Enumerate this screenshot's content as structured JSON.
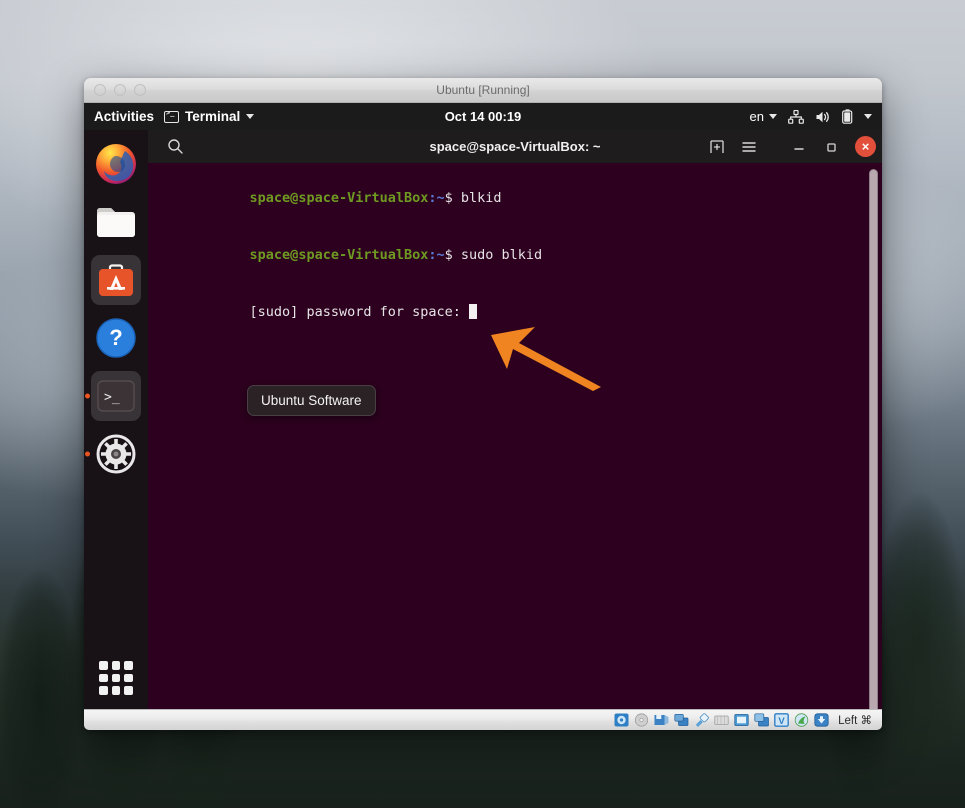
{
  "vbox": {
    "window_title": "Ubuntu [Running]",
    "traffic_lights": [
      "close",
      "minimize",
      "zoom"
    ],
    "status_bar": {
      "host_key_label": "Left ⌘",
      "icons": [
        "hard-disk-icon",
        "optical-disk-icon",
        "floppy-disk-icon",
        "network-icon",
        "usb-icon",
        "shared-folders-icon",
        "display-icon",
        "recording-icon",
        "virtualization-icon",
        "mouse-integration-icon",
        "keyboard-icon"
      ]
    }
  },
  "topbar": {
    "activities_label": "Activities",
    "app_menu_label": "Terminal",
    "clock": "Oct 14  00:19",
    "language": "en",
    "tray_icons": [
      "network-icon",
      "volume-icon",
      "battery-icon",
      "chevron-down-icon"
    ]
  },
  "dock": {
    "items": [
      {
        "name": "firefox",
        "label": "Firefox",
        "running": false,
        "focused": false
      },
      {
        "name": "files",
        "label": "Files",
        "running": false,
        "focused": false
      },
      {
        "name": "ubuntu-software",
        "label": "Ubuntu Software",
        "running": false,
        "focused": true
      },
      {
        "name": "help",
        "label": "Help",
        "running": false,
        "focused": false
      },
      {
        "name": "terminal",
        "label": "Terminal",
        "running": true,
        "focused": true
      },
      {
        "name": "settings",
        "label": "Settings",
        "running": true,
        "focused": false
      }
    ],
    "show_applications_label": "Show Applications"
  },
  "tooltip": {
    "text": "Ubuntu Software"
  },
  "terminal": {
    "title": "space@space-VirtualBox: ~",
    "header_icons": [
      "search-icon",
      "new-tab-icon",
      "menu-icon",
      "minimize-icon",
      "maximize-icon",
      "close-icon"
    ],
    "close_glyph": "×",
    "lines": [
      {
        "type": "prompt",
        "user": "space@space-VirtualBox",
        "path": ":~",
        "dollar": "$",
        "command": " blkid"
      },
      {
        "type": "prompt",
        "user": "space@space-VirtualBox",
        "path": ":~",
        "dollar": "$",
        "command": " sudo blkid"
      },
      {
        "type": "plain",
        "text": "[sudo] password for space: "
      }
    ],
    "cursor_visible": true
  },
  "annotation": {
    "arrow_color": "#f08421",
    "arrow_points_to": "password-cursor"
  },
  "colors": {
    "terminal_bg": "#2c001e",
    "accent_orange": "#e95420",
    "prompt_green": "#6f9a22",
    "prompt_blue": "#5c7bd6",
    "close_red": "#e2503b"
  }
}
